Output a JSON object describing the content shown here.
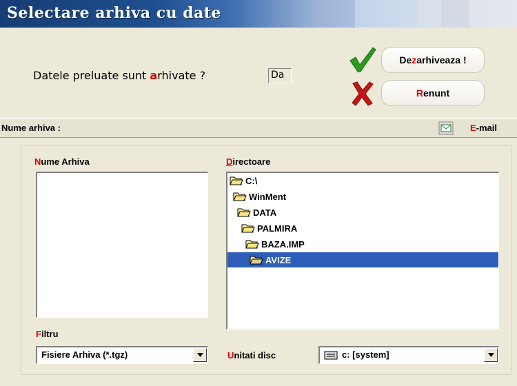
{
  "window": {
    "title": "Selectare arhiva cu date"
  },
  "question": {
    "pre": "Datele preluate sunt ",
    "hot": "a",
    "post": "rhivate ?",
    "answer": "Da"
  },
  "buttons": {
    "extract": {
      "pre": "De",
      "hot": "z",
      "post": "arhiveaza !"
    },
    "cancel": {
      "hot": "R",
      "post": "enunt"
    }
  },
  "archive_bar": {
    "label": "Nume arhiva :",
    "email": {
      "hot": "E",
      "post": "-mail"
    }
  },
  "archive_name": {
    "hot": "N",
    "post": "ume Arhiva"
  },
  "directories": {
    "hot": "D",
    "post": "irectoare",
    "items": [
      "C:\\",
      "WinMent",
      "DATA",
      "PALMIRA",
      "BAZA.IMP",
      "AVIZE"
    ]
  },
  "filter": {
    "hot": "F",
    "post": "iltru",
    "value": "Fisiere Arhiva (*.tgz)"
  },
  "drives": {
    "hot": "U",
    "post": "nitati disc",
    "value": "c: [system]"
  },
  "colors": {
    "accent_red": "#e00000",
    "selection": "#2e5fb8",
    "check_green": "#2a9a1f"
  },
  "icons": [
    "check-icon",
    "x-icon",
    "mail-icon",
    "folder-icon",
    "drive-icon",
    "dropdown-arrow-icon"
  ]
}
